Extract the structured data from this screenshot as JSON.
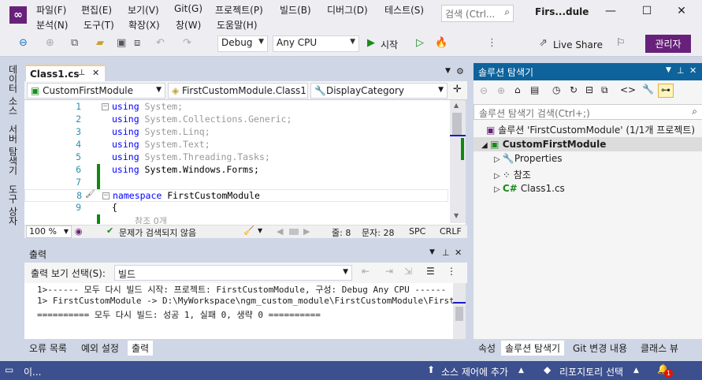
{
  "title": {
    "window_title": "Firs...dule",
    "search_placeholder": "검색 (Ctrl..."
  },
  "menu": [
    "파일(F)",
    "편집(E)",
    "보기(V)",
    "Git(G)",
    "프로젝트(P)",
    "빌드(B)",
    "디버그(D)",
    "테스트(S)",
    "분석(N)",
    "도구(T)",
    "확장(X)",
    "창(W)",
    "도움말(H)"
  ],
  "toolbar": {
    "config": "Debug",
    "platform": "Any CPU",
    "start_label": "시작",
    "live_share": "Live Share",
    "admin": "관리자"
  },
  "left_tabs": [
    "데이터 소스",
    "서버 탐색기",
    "도구 상자"
  ],
  "editor": {
    "tab_label": "Class1.cs",
    "nav_project": "CustomFirstModule",
    "nav_class": "FirstCustomModule.Class1",
    "nav_member": "DisplayCategory",
    "lines": [
      {
        "n": "1",
        "kw": "using",
        "rest": " System;"
      },
      {
        "n": "2",
        "kw": "using",
        "rest": " System.Collections.Generic;"
      },
      {
        "n": "3",
        "kw": "using",
        "rest": " System.Linq;"
      },
      {
        "n": "4",
        "kw": "using",
        "rest": " System.Text;"
      },
      {
        "n": "5",
        "kw": "using",
        "rest": " System.Threading.Tasks;"
      },
      {
        "n": "6",
        "kw": "using",
        "rest": " System.Windows.Forms;"
      },
      {
        "n": "7",
        "kw": "",
        "rest": ""
      },
      {
        "n": "8",
        "kw": "namespace",
        "rest": " FirstCustomModule"
      },
      {
        "n": "9",
        "kw": "",
        "rest": "{"
      }
    ],
    "ref_hint": "참조 0개",
    "zoom": "100 %",
    "issues": "문제가 검색되지 않음",
    "line_info": "줄: 8",
    "col_info": "문자: 28",
    "spc": "SPC",
    "crlf": "CRLF"
  },
  "output": {
    "title": "출력",
    "source_label": "출력 보기 선택(S):",
    "source_value": "빌드",
    "lines": [
      "1>------ 모두 다시 빌드 시작: 프로젝트: FirstCustomModule, 구성: Debug Any CPU ------",
      "1>  FirstCustomModule -> D:\\MyWorkspace\\ngm_custom_module\\FirstCustomModule\\FirstCustomM",
      "========== 모두 다시 빌드: 성공 1, 실패 0, 생략 0 =========="
    ],
    "tabs": [
      "오류 목록",
      "예외 설정",
      "출력"
    ]
  },
  "solution": {
    "title": "솔루션 탐색기",
    "search_placeholder": "솔루션 탐색기 검색(Ctrl+;)",
    "root": "솔루션 'FirstCustomModule' (1/1개 프로젝트)",
    "project": "CustomFirstModule",
    "items": [
      "Properties",
      "참조",
      "Class1.cs"
    ],
    "tabs": [
      "속성",
      "솔루션 탐색기",
      "Git 변경 내용",
      "클래스 뷰"
    ]
  },
  "statusbar": {
    "left": "이...",
    "source_control": "소스 제어에 추가",
    "repo": "리포지토리 선택",
    "notif": "1"
  }
}
